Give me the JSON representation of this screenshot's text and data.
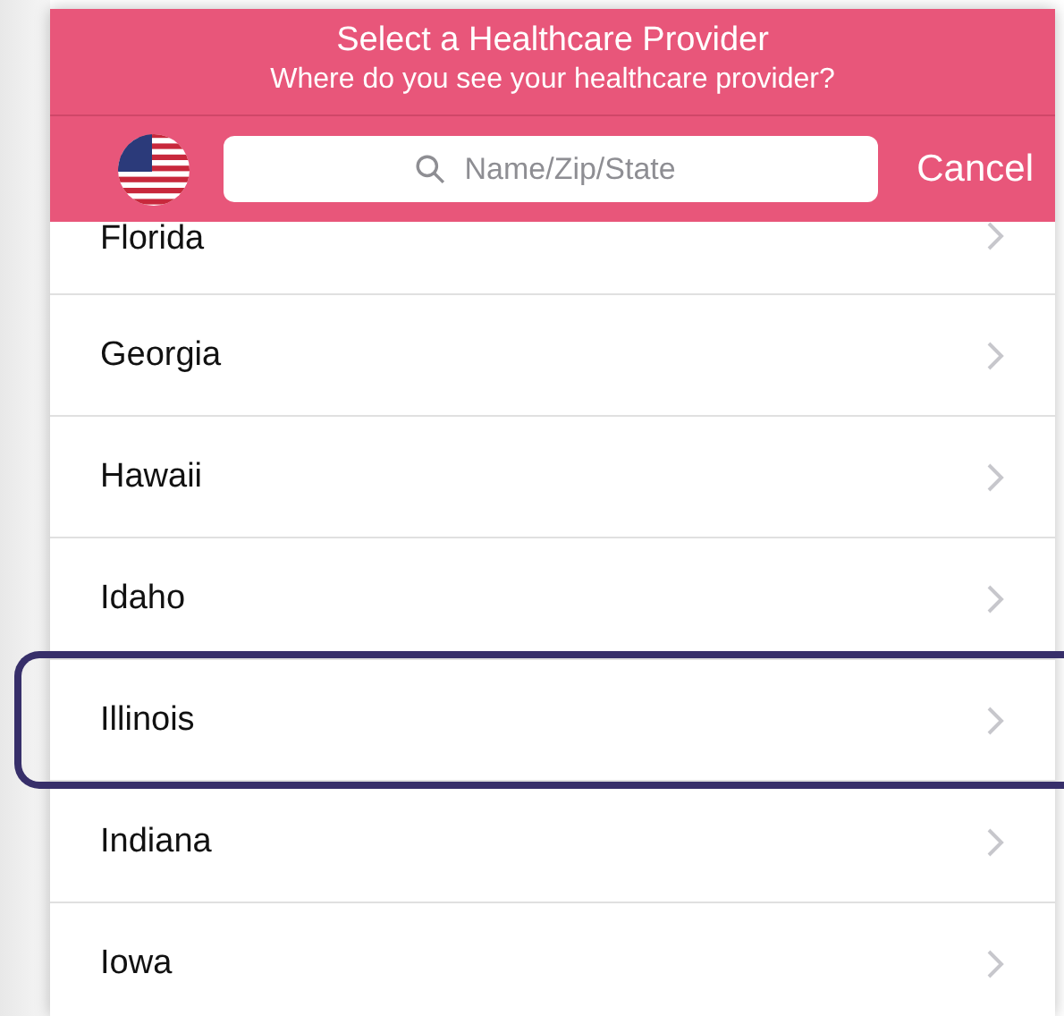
{
  "header": {
    "title": "Select a Healthcare Provider",
    "subtitle": "Where do you see your healthcare provider?"
  },
  "search": {
    "placeholder": "Name/Zip/State"
  },
  "cancel": "Cancel",
  "states": [
    {
      "name": "Florida",
      "highlighted": false
    },
    {
      "name": "Georgia",
      "highlighted": false
    },
    {
      "name": "Hawaii",
      "highlighted": false
    },
    {
      "name": "Idaho",
      "highlighted": false
    },
    {
      "name": "Illinois",
      "highlighted": true
    },
    {
      "name": "Indiana",
      "highlighted": false
    },
    {
      "name": "Iowa",
      "highlighted": false
    }
  ]
}
